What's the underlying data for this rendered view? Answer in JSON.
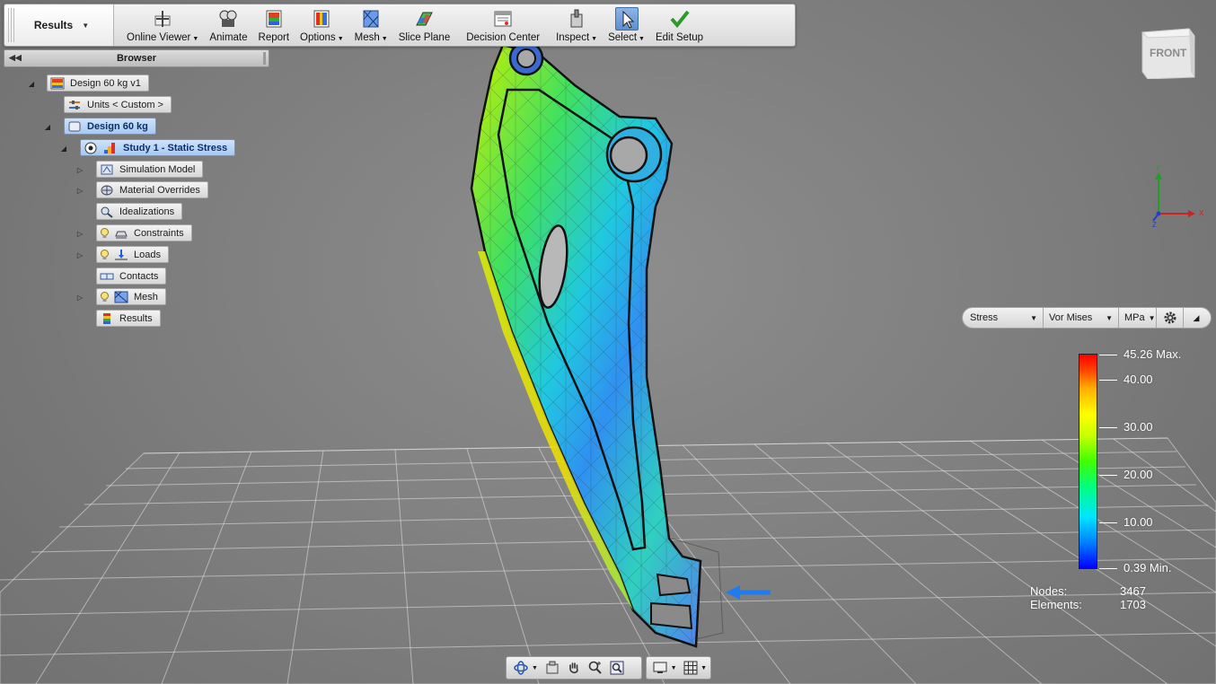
{
  "ribbon": {
    "results_tab": "Results",
    "tools": [
      {
        "label": "Online Viewer",
        "icon": "online-viewer-icon",
        "has_dropdown": true
      },
      {
        "label": "Animate",
        "icon": "animate-icon",
        "has_dropdown": false
      },
      {
        "label": "Report",
        "icon": "report-icon",
        "has_dropdown": false
      },
      {
        "label": "Options",
        "icon": "options-icon",
        "has_dropdown": true
      },
      {
        "label": "Mesh",
        "icon": "mesh-icon",
        "has_dropdown": true
      },
      {
        "label": "Slice Plane",
        "icon": "slice-plane-icon",
        "has_dropdown": false
      },
      {
        "label": "Decision Center",
        "icon": "decision-center-icon",
        "has_dropdown": false
      },
      {
        "label": "Inspect",
        "icon": "inspect-icon",
        "has_dropdown": true
      },
      {
        "label": "Select",
        "icon": "select-cursor-icon",
        "has_dropdown": true,
        "active": true
      },
      {
        "label": "Edit Setup",
        "icon": "checkmark-icon",
        "has_dropdown": false
      }
    ]
  },
  "browser": {
    "title": "Browser",
    "tree": {
      "root": "Design 60 kg v1",
      "units": "Units < Custom >",
      "design": "Design 60 kg",
      "study": "Study 1 - Static Stress",
      "children": [
        {
          "label": "Simulation Model",
          "icon": "simulation-model-icon"
        },
        {
          "label": "Material Overrides",
          "icon": "material-overrides-icon"
        },
        {
          "label": "Idealizations",
          "icon": "idealizations-icon"
        },
        {
          "label": "Constraints",
          "icon": "constraints-icon"
        },
        {
          "label": "Loads",
          "icon": "loads-icon"
        },
        {
          "label": "Contacts",
          "icon": "contacts-icon"
        },
        {
          "label": "Mesh",
          "icon": "mesh-node-icon"
        },
        {
          "label": "Results",
          "icon": "results-icon"
        }
      ]
    }
  },
  "viewcube": {
    "face": "FRONT"
  },
  "axes": {
    "x": "X",
    "y": "Y",
    "z": "Z"
  },
  "result_selector": {
    "result_type": "Stress",
    "component": "Vor Mises",
    "unit": "MPa"
  },
  "legend": {
    "max_label": "45.26 Max.",
    "min_label": "0.39 Min.",
    "ticks": [
      "40.00",
      "30.00",
      "20.00",
      "10.00"
    ],
    "colors": [
      "#0000ff",
      "#00e5ff",
      "#40ff00",
      "#ffff00",
      "#ff0000"
    ]
  },
  "mesh_stats": {
    "nodes_label": "Nodes:",
    "nodes_value": "3467",
    "elements_label": "Elements:",
    "elements_value": "1703"
  }
}
